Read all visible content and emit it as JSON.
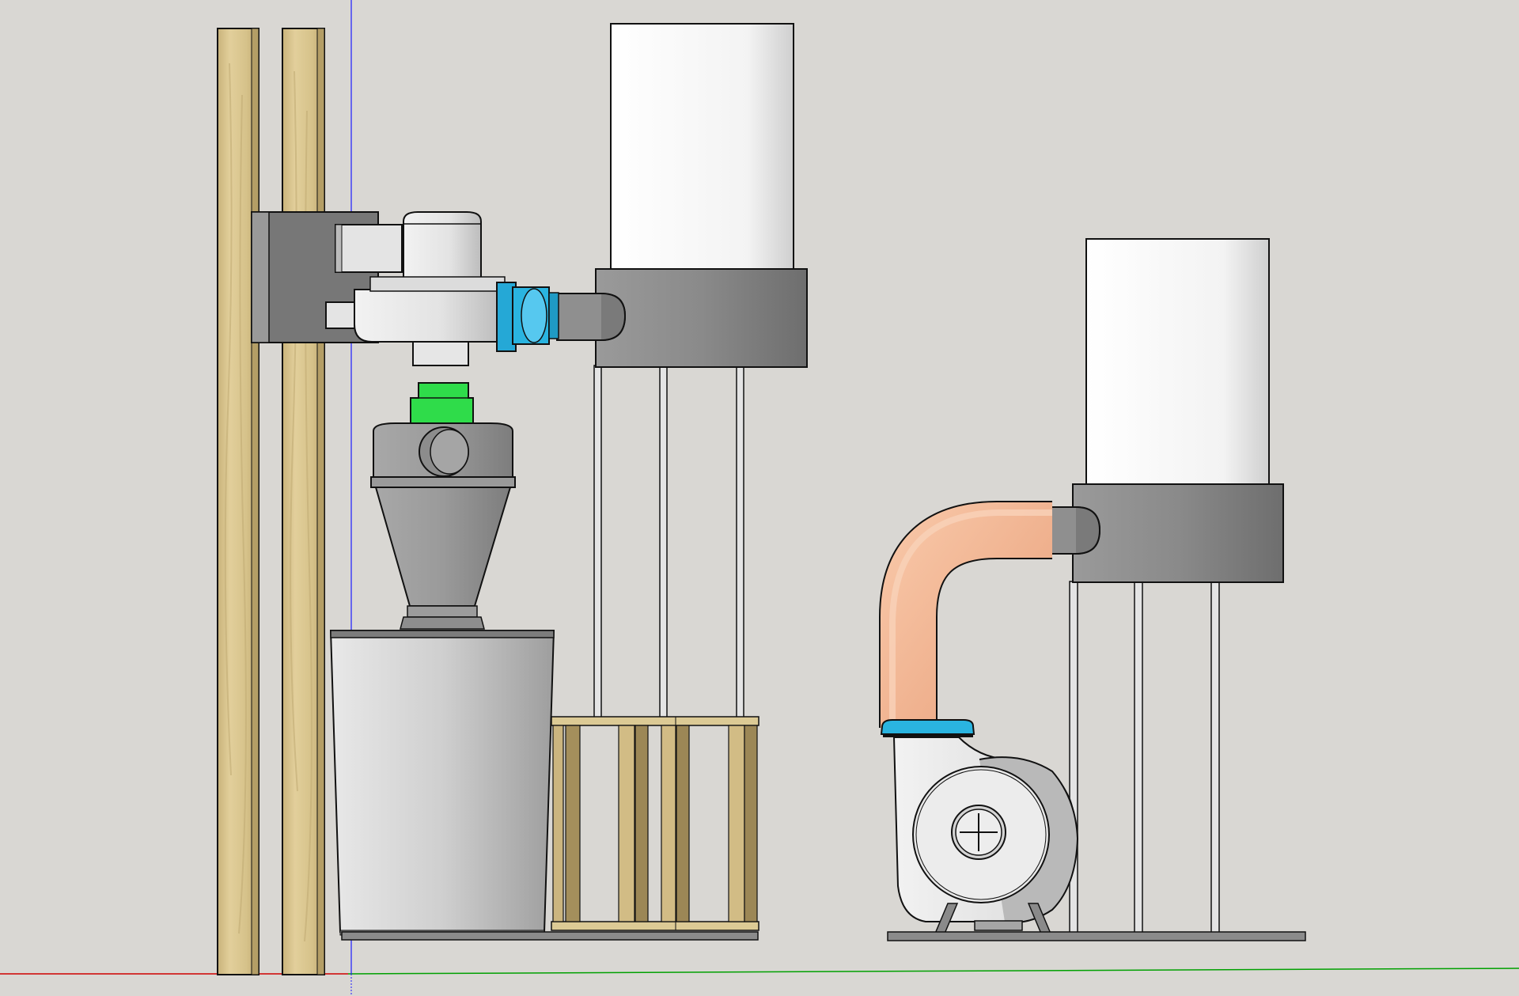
{
  "canvas": {
    "background": "#d9d7d3"
  },
  "colors": {
    "wood": "#d8c48e",
    "wood_dark": "#b9a36c",
    "metal_gray": "#8a8a8a",
    "metal_light": "#e9e9e9",
    "bag_white": "#f4f4f4",
    "adapter_cyan": "#2ab4e0",
    "reducer_green": "#2fdc4a",
    "hose_peach": "#f2b38f",
    "axis_red": "#d00000",
    "axis_green": "#00a000",
    "axis_blue": "#1a1aff",
    "outline": "#111111"
  },
  "scene": {
    "components": [
      "wood-studs",
      "wall-mounted-blower",
      "cyclone-separator",
      "collection-bin",
      "filter-bag-stand-left",
      "wooden-crate",
      "floor-standing-blower",
      "flex-hose",
      "filter-bag-stand-right"
    ]
  }
}
